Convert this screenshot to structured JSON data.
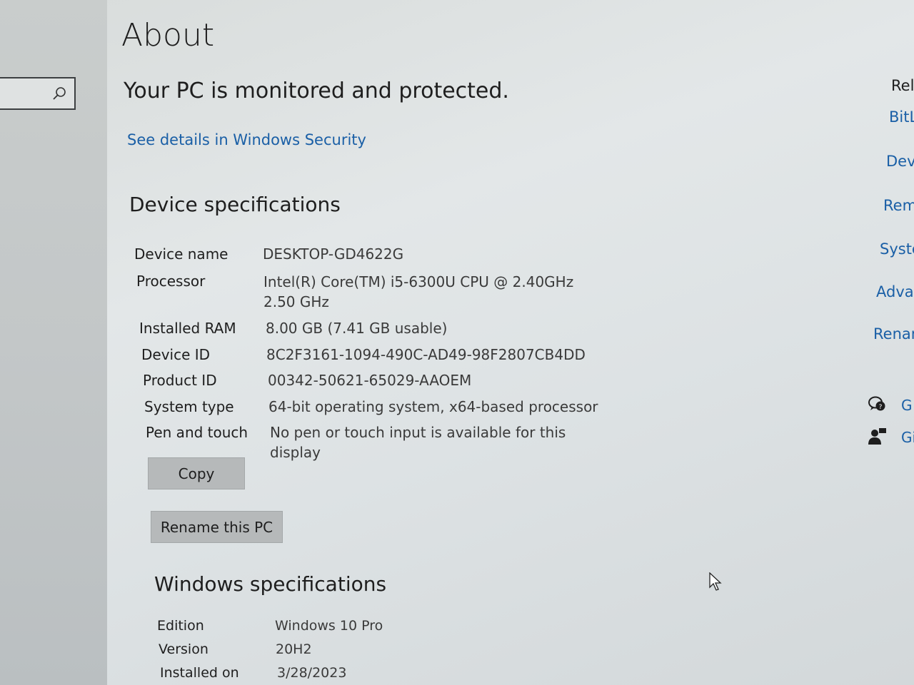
{
  "sidebar": {
    "search_placeholder": "",
    "search_icon": "search-icon"
  },
  "header": {
    "title": "About"
  },
  "security": {
    "status": "Your PC is monitored and protected.",
    "link": "See details in Windows Security"
  },
  "device_specs": {
    "heading": "Device specifications",
    "rows": [
      {
        "label": "Device name",
        "value": "DESKTOP-GD4622G"
      },
      {
        "label": "Processor",
        "value": "Intel(R) Core(TM) i5-6300U CPU @ 2.40GHz   2.50 GHz"
      },
      {
        "label": "Installed RAM",
        "value": "8.00 GB (7.41 GB usable)"
      },
      {
        "label": "Device ID",
        "value": "8C2F3161-1094-490C-AD49-98F2807CB4DD"
      },
      {
        "label": "Product ID",
        "value": "00342-50621-65029-AAOEM"
      },
      {
        "label": "System type",
        "value": "64-bit operating system, x64-based processor"
      },
      {
        "label": "Pen and touch",
        "value": "No pen or touch input is available for this display"
      }
    ],
    "copy_button": "Copy",
    "rename_button": "Rename this PC"
  },
  "windows_specs": {
    "heading": "Windows specifications",
    "rows": [
      {
        "label": "Edition",
        "value": "Windows 10 Pro"
      },
      {
        "label": "Version",
        "value": "20H2"
      },
      {
        "label": "Installed on",
        "value": "3/28/2023"
      }
    ]
  },
  "related": {
    "heading": "Rel",
    "links": [
      "BitL",
      "Devi",
      "Rem",
      "Syste",
      "Advar",
      "Renam"
    ],
    "help_links": [
      "G",
      "Gi"
    ]
  }
}
